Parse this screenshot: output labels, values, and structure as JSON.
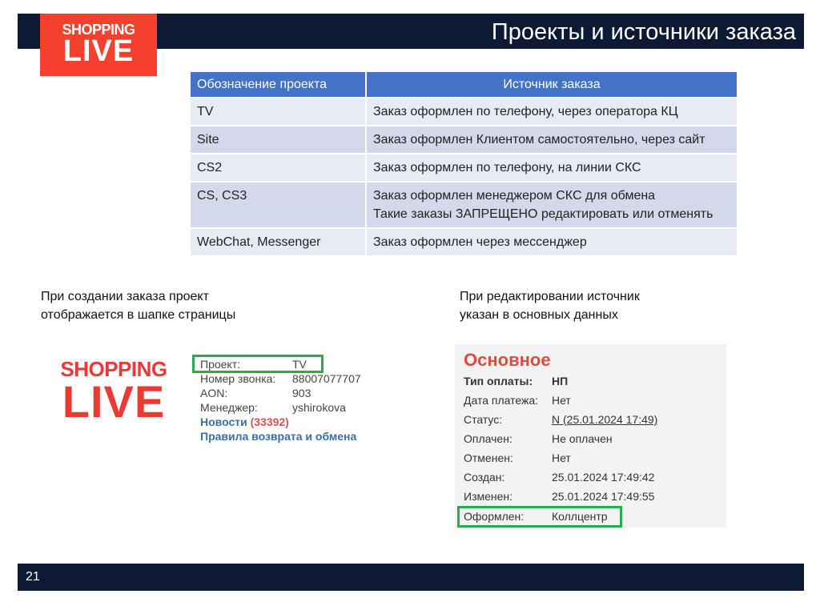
{
  "slide": {
    "title": "Проекты и источники заказа",
    "page_number": "21"
  },
  "logo": {
    "line1": "SHOPPING",
    "line2": "LIVE",
    "brand_color": "#f4402c"
  },
  "table": {
    "headers": [
      "Обозначение проекта",
      "Источник заказа"
    ],
    "rows": [
      {
        "project": "TV",
        "source": "Заказ оформлен по телефону, через оператора КЦ"
      },
      {
        "project": "Site",
        "source": "Заказ оформлен Клиентом самостоятельно, через сайт"
      },
      {
        "project": "CS2",
        "source": "Заказ оформлен по телефону, на линии СКС"
      },
      {
        "project": "CS, CS3",
        "source": "Заказ оформлен менеджером СКС для обмена",
        "note": "Такие заказы ЗАПРЕЩЕНО редактировать или отменять"
      },
      {
        "project": "WebChat, Messenger",
        "source": "Заказ оформлен через мессенджер"
      }
    ],
    "header_color": "#4472c4"
  },
  "caption_left": {
    "line1": "При создании заказа проект",
    "line2": "отображается в шапке страницы"
  },
  "caption_right": {
    "line1": "При редактировании источник",
    "line2": "указан в основных данных"
  },
  "header_info": {
    "rows": [
      {
        "label": "Проект:",
        "value": "TV"
      },
      {
        "label": "Номер звонка:",
        "value": "88007077707"
      },
      {
        "label": "AON:",
        "value": "903"
      },
      {
        "label": "Менеджер:",
        "value": "yshirokova"
      }
    ],
    "news_label": "Новости",
    "news_count": "(33392)",
    "returns_link": "Правила возврата и обмена"
  },
  "main_info": {
    "heading": "Основное",
    "rows": [
      {
        "label": "Тип оплаты:",
        "value": "НП"
      },
      {
        "label": "Дата платежа:",
        "value": "Нет"
      },
      {
        "label": "Статус:",
        "value": "N (25.01.2024 17:49)"
      },
      {
        "label": "Оплачен:",
        "value": "Не оплачен"
      },
      {
        "label": "Отменен:",
        "value": "Нет"
      },
      {
        "label": "Создан:",
        "value": "25.01.2024 17:49:42"
      },
      {
        "label": "Изменен:",
        "value": "25.01.2024 17:49:55"
      },
      {
        "label": "Оформлен:",
        "value": "Коллцентр"
      }
    ]
  },
  "highlight_color": "#2eab49"
}
